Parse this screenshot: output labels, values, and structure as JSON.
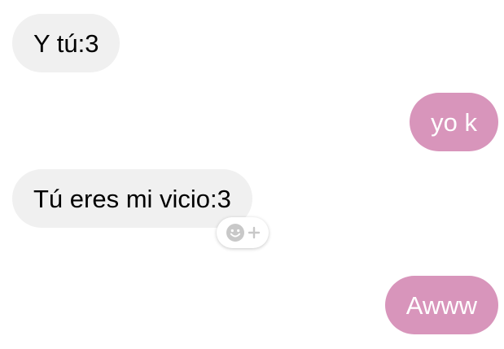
{
  "messages": [
    {
      "direction": "incoming",
      "text": "Y tú:3"
    },
    {
      "direction": "outgoing",
      "text": "yo k"
    },
    {
      "direction": "incoming",
      "text": "Tú eres mi vicio:3"
    },
    {
      "direction": "outgoing",
      "text": "Awww"
    }
  ],
  "colors": {
    "incoming_bubble": "#f0f0f0",
    "outgoing_bubble": "#d895bb",
    "reaction_icon": "#c8c8c8"
  },
  "reaction_button": {
    "icons": [
      "smiley-icon",
      "plus-icon"
    ]
  }
}
